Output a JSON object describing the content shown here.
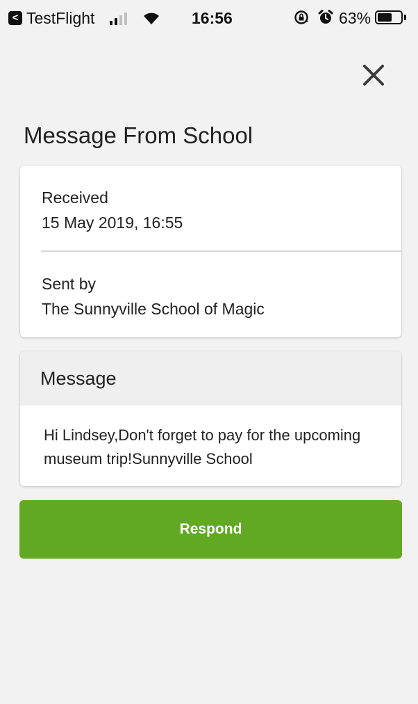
{
  "status_bar": {
    "carrier": "TestFlight",
    "back_symbol": "<",
    "signal_icon": "signal-bars-icon",
    "signal_bars": 2,
    "signal_bars_total": 4,
    "wifi_icon": "wifi-icon",
    "time": "16:56",
    "lock_icon": "orientation-lock-icon",
    "alarm_icon": "alarm-clock-icon",
    "battery_percent": "63%",
    "battery_level": 0.63
  },
  "close_icon": "close-icon",
  "page": {
    "title": "Message From School"
  },
  "details": {
    "received_label": "Received",
    "received_value": "15 May 2019, 16:55",
    "sent_by_label": "Sent by",
    "sent_by_value": "The Sunnyville School of Magic"
  },
  "message": {
    "heading": "Message",
    "body": "Hi Lindsey,Don't forget to pay for the upcoming museum trip!Sunnyville School"
  },
  "actions": {
    "respond_label": "Respond"
  },
  "colors": {
    "background": "#f2f2f2",
    "card": "#ffffff",
    "message_header": "#efefef",
    "accent": "#62a923",
    "text": "#222222"
  }
}
